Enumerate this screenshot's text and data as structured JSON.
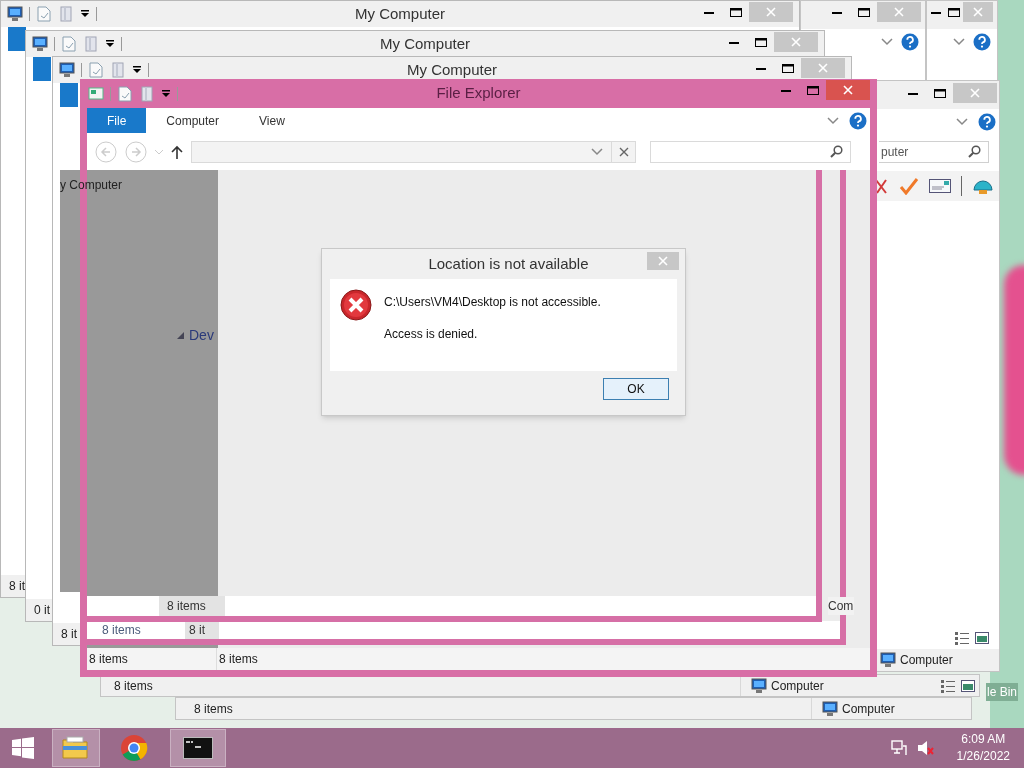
{
  "background_windows": [
    {
      "title": "My Computer",
      "status": "8 it"
    },
    {
      "title": "My Computer",
      "status": "0 it"
    },
    {
      "title": "My Computer",
      "status": "8 it"
    }
  ],
  "lower_windows": [
    {
      "status": "8 items",
      "location": "Computer"
    },
    {
      "status": "8 items",
      "location": "Computer"
    }
  ],
  "side_window": {
    "search_value": "puter",
    "location": "Computer"
  },
  "nav_peek": {
    "label": "y Computer"
  },
  "explorer": {
    "title": "File Explorer",
    "tabs": [
      {
        "label": "File",
        "selected": true
      },
      {
        "label": "Computer",
        "selected": false
      },
      {
        "label": "View",
        "selected": false
      }
    ],
    "nav_group": "Dev",
    "ghost_frames": [
      {
        "status": "8 items",
        "status_2": "8 it",
        "edge_text": "Com"
      },
      {
        "status": "8 items"
      }
    ],
    "status": [
      "8 items",
      "8 items"
    ]
  },
  "dialog": {
    "title": "Location is not available",
    "message": "C:\\Users\\VM4\\Desktop is not accessible.",
    "detail": "Access is denied.",
    "button": "OK"
  },
  "desktop": {
    "icon_label": "le Bin"
  },
  "taskbar": {
    "apps": [
      {
        "kind": "explorer",
        "highlighted": true
      },
      {
        "kind": "chrome",
        "highlighted": false
      },
      {
        "kind": "cmd",
        "highlighted": true
      }
    ],
    "time": "6:09 AM",
    "date": "1/26/2022"
  }
}
